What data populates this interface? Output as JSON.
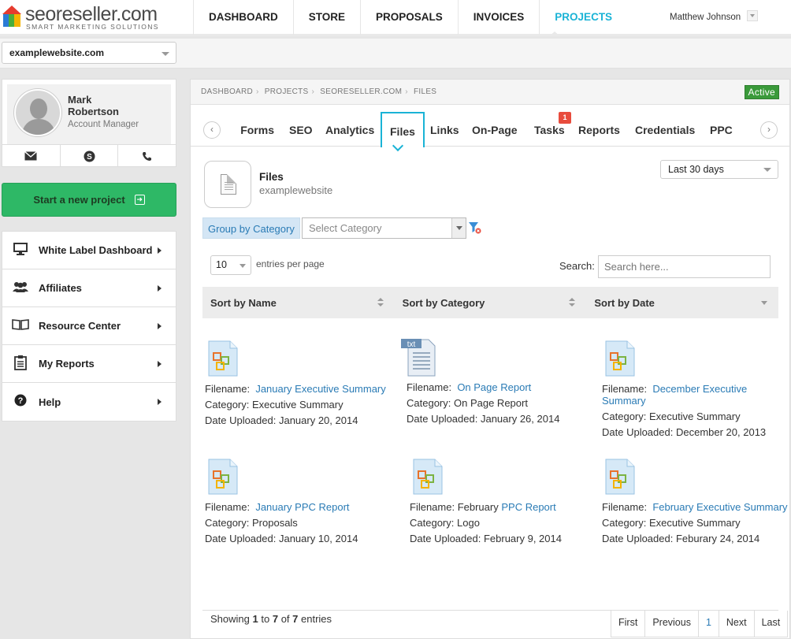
{
  "header": {
    "brand": "seoreseller.com",
    "tagline": "SMART MARKETING SOLUTIONS",
    "nav": [
      "DASHBOARD",
      "STORE",
      "PROPOSALS",
      "INVOICES",
      "PROJECTS"
    ],
    "user_name": "Matthew Johnson"
  },
  "site_selector": {
    "value": "examplewebsite.com"
  },
  "profile": {
    "name": "Mark Robertson",
    "role": "Account Manager"
  },
  "start_button": "Start a new project",
  "menu": [
    {
      "label": "White Label Dashboard",
      "icon": "monitor-icon"
    },
    {
      "label": "Affiliates",
      "icon": "users-icon"
    },
    {
      "label": "Resource Center",
      "icon": "book-icon"
    },
    {
      "label": "My Reports",
      "icon": "clipboard-icon"
    },
    {
      "label": "Help",
      "icon": "question-icon"
    }
  ],
  "breadcrumb": [
    "DASHBOARD",
    "PROJECTS",
    "SEORESELLER.COM",
    "FILES"
  ],
  "status_badge": "Active",
  "tabs": [
    "Forms",
    "SEO",
    "Analytics",
    "Files",
    "Links",
    "On-Page",
    "Tasks",
    "Reports",
    "Credentials",
    "PPC"
  ],
  "tasks_count": "1",
  "hero": {
    "title": "Files",
    "subtitle": "examplewebsite"
  },
  "date_range": "Last 30 days",
  "group": {
    "label": "Group by Category",
    "placeholder": "Select Category"
  },
  "entries": {
    "value": "10",
    "label": "entries per page"
  },
  "search": {
    "label": "Search:",
    "placeholder": "Search here..."
  },
  "sort": [
    "Sort by Name",
    "Sort by Category",
    "Sort by Date"
  ],
  "labels": {
    "filename": "Filename:",
    "category": "Category:",
    "date": "Date Uploaded:"
  },
  "files": [
    {
      "name": "January Executive Summary",
      "category": "Executive Summary",
      "date": "January 20, 2014",
      "type": "image"
    },
    {
      "name": "On Page Report",
      "category": "On Page Report",
      "date": "January 26, 2014",
      "type": "txt"
    },
    {
      "name": "December Executive Summary",
      "category": "Executive Summary",
      "date": "December 20, 2013",
      "type": "image"
    },
    {
      "name": "January PPC Report",
      "category": "Proposals",
      "date": "January 10, 2014",
      "type": "image"
    },
    {
      "name_prefix": "February",
      "name": "PPC Report",
      "category": "Logo",
      "date": "February 9, 2014",
      "type": "image"
    },
    {
      "name": "February Executive Summary",
      "category": "Executive Summary",
      "date": "Feburary 24, 2014",
      "type": "image"
    }
  ],
  "footer": {
    "prefix": "Showing",
    "from": "1",
    "to_word": "to",
    "to": "7",
    "of_word": "of",
    "total": "7",
    "suffix": "entries"
  },
  "pager": [
    "First",
    "Previous",
    "1",
    "Next",
    "Last"
  ],
  "txt_icon_label": "txt"
}
